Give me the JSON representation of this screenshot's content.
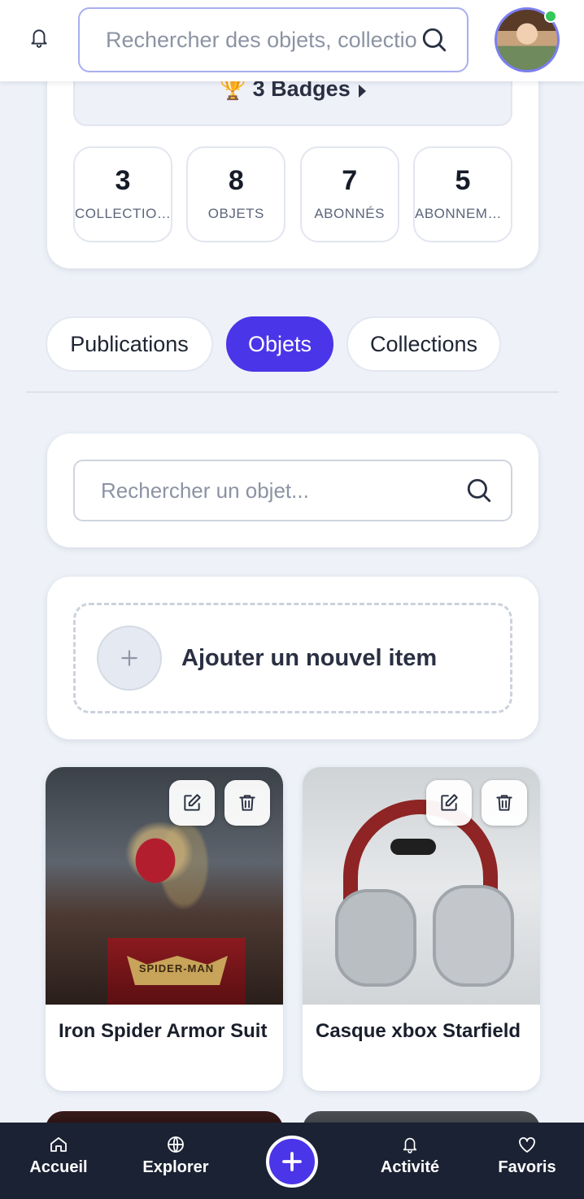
{
  "header": {
    "search_placeholder": "Rechercher des objets, collections..."
  },
  "profile": {
    "badges_label": "3 Badges",
    "stats": [
      {
        "value": "3",
        "label": "COLLECTIONS"
      },
      {
        "value": "8",
        "label": "OBJETS"
      },
      {
        "value": "7",
        "label": "ABONNÉS"
      },
      {
        "value": "5",
        "label": "ABONNEMENTS"
      }
    ]
  },
  "tabs": [
    {
      "label": "Publications",
      "active": false
    },
    {
      "label": "Objets",
      "active": true
    },
    {
      "label": "Collections",
      "active": false
    }
  ],
  "objects": {
    "search_placeholder": "Rechercher un objet...",
    "add_label": "Ajouter un nouvel item",
    "items": [
      {
        "title": "Iron Spider Armor Suit",
        "image": "iron-spider-figure"
      },
      {
        "title": "Casque xbox Starfield",
        "image": "xbox-headset"
      }
    ]
  },
  "bottom_nav": {
    "home": "Accueil",
    "explore": "Explorer",
    "activity": "Activité",
    "favorites": "Favoris"
  },
  "colors": {
    "accent": "#4b35e8",
    "nav_bg": "#1b2233",
    "online": "#34c759"
  }
}
